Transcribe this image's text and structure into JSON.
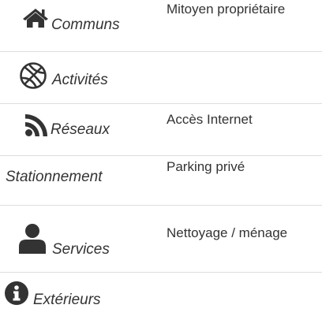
{
  "rows": [
    {
      "label": "Communs",
      "icon": "home-icon",
      "value": "Mitoyen propriétaire"
    },
    {
      "label": "Activités",
      "icon": "basketball-icon",
      "value": ""
    },
    {
      "label": "Réseaux",
      "icon": "rss-icon",
      "value": "Accès Internet"
    },
    {
      "label": "Stationnement",
      "icon": "",
      "value": "Parking privé"
    },
    {
      "label": "Services",
      "icon": "user-icon",
      "value": "Nettoyage / ménage"
    },
    {
      "label": "Extérieurs",
      "icon": "info-circle-icon",
      "value": ""
    }
  ]
}
